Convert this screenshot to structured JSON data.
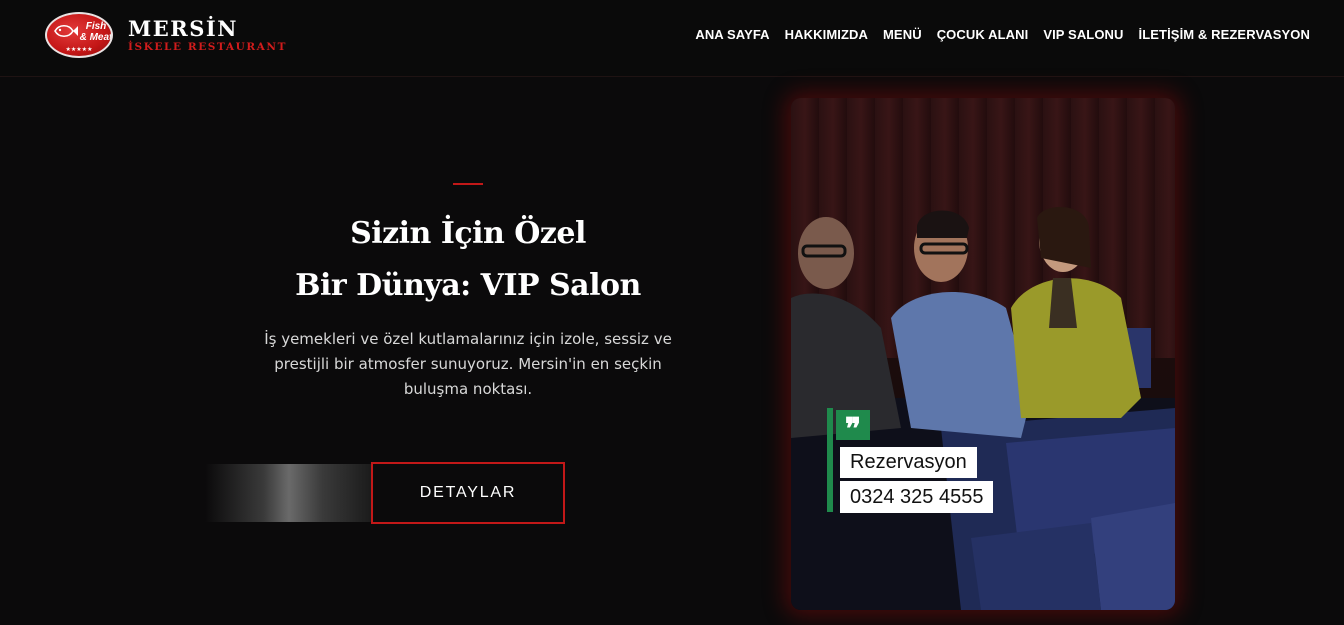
{
  "header": {
    "logo_badge_lines": [
      "Fish",
      "& Meat"
    ],
    "logo_badge_stars": "★★★★★",
    "brand_name": "MERSİN",
    "brand_subtitle": "İSKELE RESTAURANT"
  },
  "nav": {
    "items": [
      {
        "label": "ANA SAYFA"
      },
      {
        "label": "HAKKIMIZDA"
      },
      {
        "label": "MENÜ"
      },
      {
        "label": "ÇOCUK ALANI"
      },
      {
        "label": "VIP SALONU"
      },
      {
        "label": "İLETİŞİM & REZERVASYON"
      }
    ]
  },
  "hero": {
    "title_line1": "Sizin İçin Özel",
    "title_line2": "Bir Dünya: VIP Salon",
    "description": "İş yemekleri ve özel kutlamalarınız için izole, sessiz ve prestijli bir atmosfer sunuyoruz. Mersin'in en seçkin buluşma noktası.",
    "button_label": "DETAYLAR"
  },
  "video_overlay": {
    "quote_glyph": "❞",
    "label": "Rezervasyon",
    "phone": "0324 325 4555"
  },
  "colors": {
    "accent": "#c21818",
    "overlay_green": "#1f8a4c",
    "background": "#0b0a0b"
  }
}
